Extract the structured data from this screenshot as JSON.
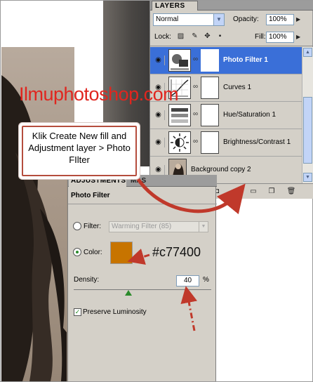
{
  "layers_panel": {
    "tab_label": "LAYERS",
    "blend_mode": "Normal",
    "opacity_label": "Opacity:",
    "opacity_value": "100%",
    "lock_label": "Lock:",
    "fill_label": "Fill:",
    "fill_value": "100%",
    "layers": [
      {
        "name": "Photo Filter 1",
        "selected": true,
        "icon": "photo-filter-adjustment-icon"
      },
      {
        "name": "Curves 1",
        "selected": false,
        "icon": "curves-adjustment-icon"
      },
      {
        "name": "Hue/Saturation 1",
        "selected": false,
        "icon": "hue-saturation-adjustment-icon"
      },
      {
        "name": "Brightness/Contrast 1",
        "selected": false,
        "icon": "brightness-contrast-adjustment-icon"
      },
      {
        "name": "Background copy 2",
        "selected": false,
        "icon": "photo-thumbnail"
      }
    ],
    "footer_icons": [
      "link-layers-icon",
      "fx-icon",
      "add-mask-icon",
      "new-adjustment-layer-icon",
      "new-group-icon",
      "new-layer-icon",
      "trash-icon"
    ]
  },
  "adjustments_panel": {
    "tab_label": "ADJUSTMENTS",
    "mask_tab_label": "MAS",
    "title": "Photo Filter",
    "filter_label": "Filter:",
    "filter_value": "Warming Filter (85)",
    "color_label": "Color:",
    "color_value": "#c77400",
    "density_label": "Density:",
    "density_value": "40",
    "density_unit": "%",
    "density_fraction": 0.4,
    "preserve_luminosity_label": "Preserve Luminosity",
    "preserve_luminosity_checked": true
  },
  "annotations": {
    "watermark": "Ilmuphotoshop.com",
    "callout_text": "Klik Create New fill and Adjustment layer > Photo FIlter",
    "hex_label": "#c77400"
  },
  "colors": {
    "selection_blue": "#3a6fd8",
    "accent_red": "#c0392b",
    "photo_filter_color": "#c77400"
  }
}
